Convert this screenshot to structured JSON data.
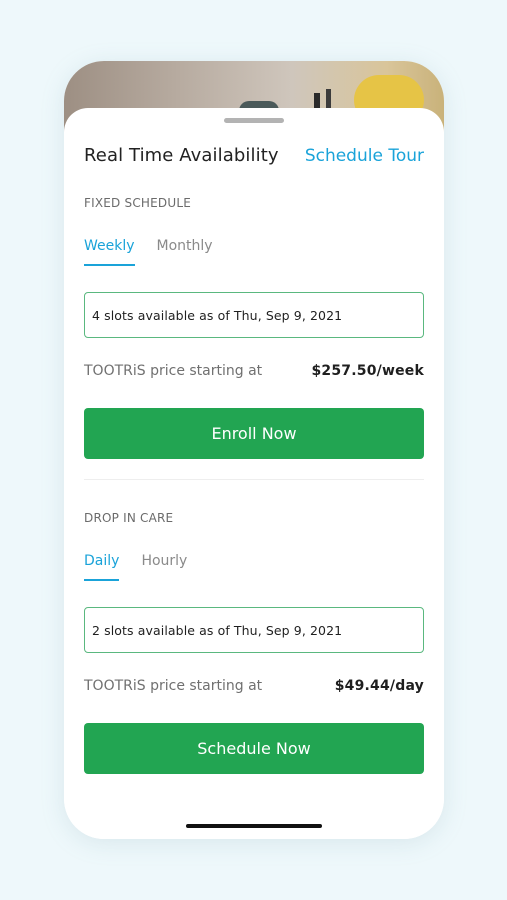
{
  "header": {
    "title": "Real Time Availability",
    "schedule_tour": "Schedule Tour"
  },
  "fixed_schedule": {
    "section_label": "FIXED SCHEDULE",
    "tabs": [
      {
        "label": "Weekly",
        "active": true
      },
      {
        "label": "Monthly",
        "active": false
      }
    ],
    "slots_text": "4 slots available as of Thu, Sep 9, 2021",
    "price_label": "TOOTRiS price starting at",
    "price_value": "$257.50/week",
    "cta_label": "Enroll Now"
  },
  "drop_in_care": {
    "section_label": "DROP IN CARE",
    "tabs": [
      {
        "label": "Daily",
        "active": true
      },
      {
        "label": "Hourly",
        "active": false
      }
    ],
    "slots_text": "2 slots available as of Thu, Sep 9, 2021",
    "price_label": "TOOTRiS price starting at",
    "price_value": "$49.44/day",
    "cta_label": "Schedule Now"
  },
  "colors": {
    "accent_blue": "#1aa3d9",
    "cta_green": "#22a552",
    "border_green": "#5ab87f",
    "background": "#eef8fb"
  }
}
